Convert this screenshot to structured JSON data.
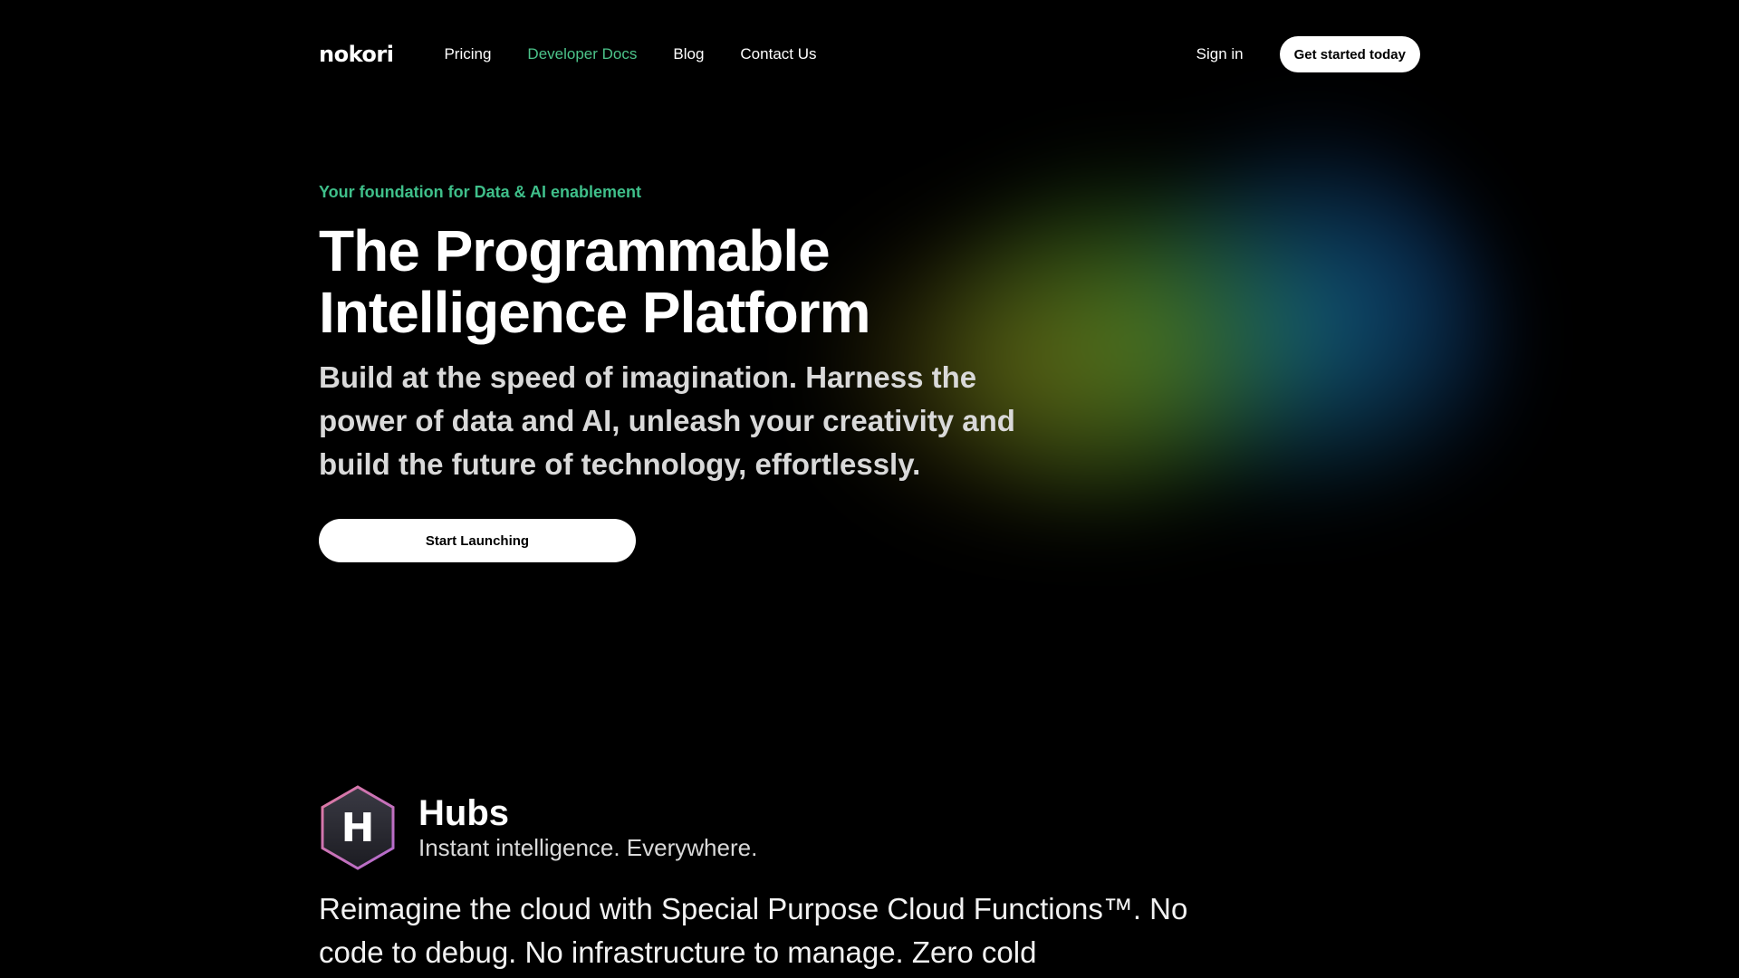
{
  "nav": {
    "logo": "nokori",
    "links": [
      {
        "label": "Pricing",
        "active": false
      },
      {
        "label": "Developer Docs",
        "active": true
      },
      {
        "label": "Blog",
        "active": false
      },
      {
        "label": "Contact Us",
        "active": false
      }
    ],
    "sign_in": "Sign in",
    "cta": "Get started today"
  },
  "hero": {
    "eyebrow": "Your foundation for Data & AI enablement",
    "headline_line1": "The Programmable",
    "headline_line2": "Intelligence Platform",
    "subhead": "Build at the speed of imagination. Harness the power of data and AI, unleash your creativity and build the future of technology, effortlessly.",
    "cta": "Start Launching"
  },
  "hubs": {
    "icon": "hexagon-h-icon",
    "icon_letter": "H",
    "title": "Hubs",
    "tagline": "Instant intelligence. Everywhere.",
    "body": "Reimagine the cloud with Special Purpose Cloud Functions™. No code to debug. No infrastructure to manage. Zero cold"
  },
  "colors": {
    "background": "#000000",
    "accent_green": "#4cc38a",
    "button_bg": "#ffffff"
  }
}
